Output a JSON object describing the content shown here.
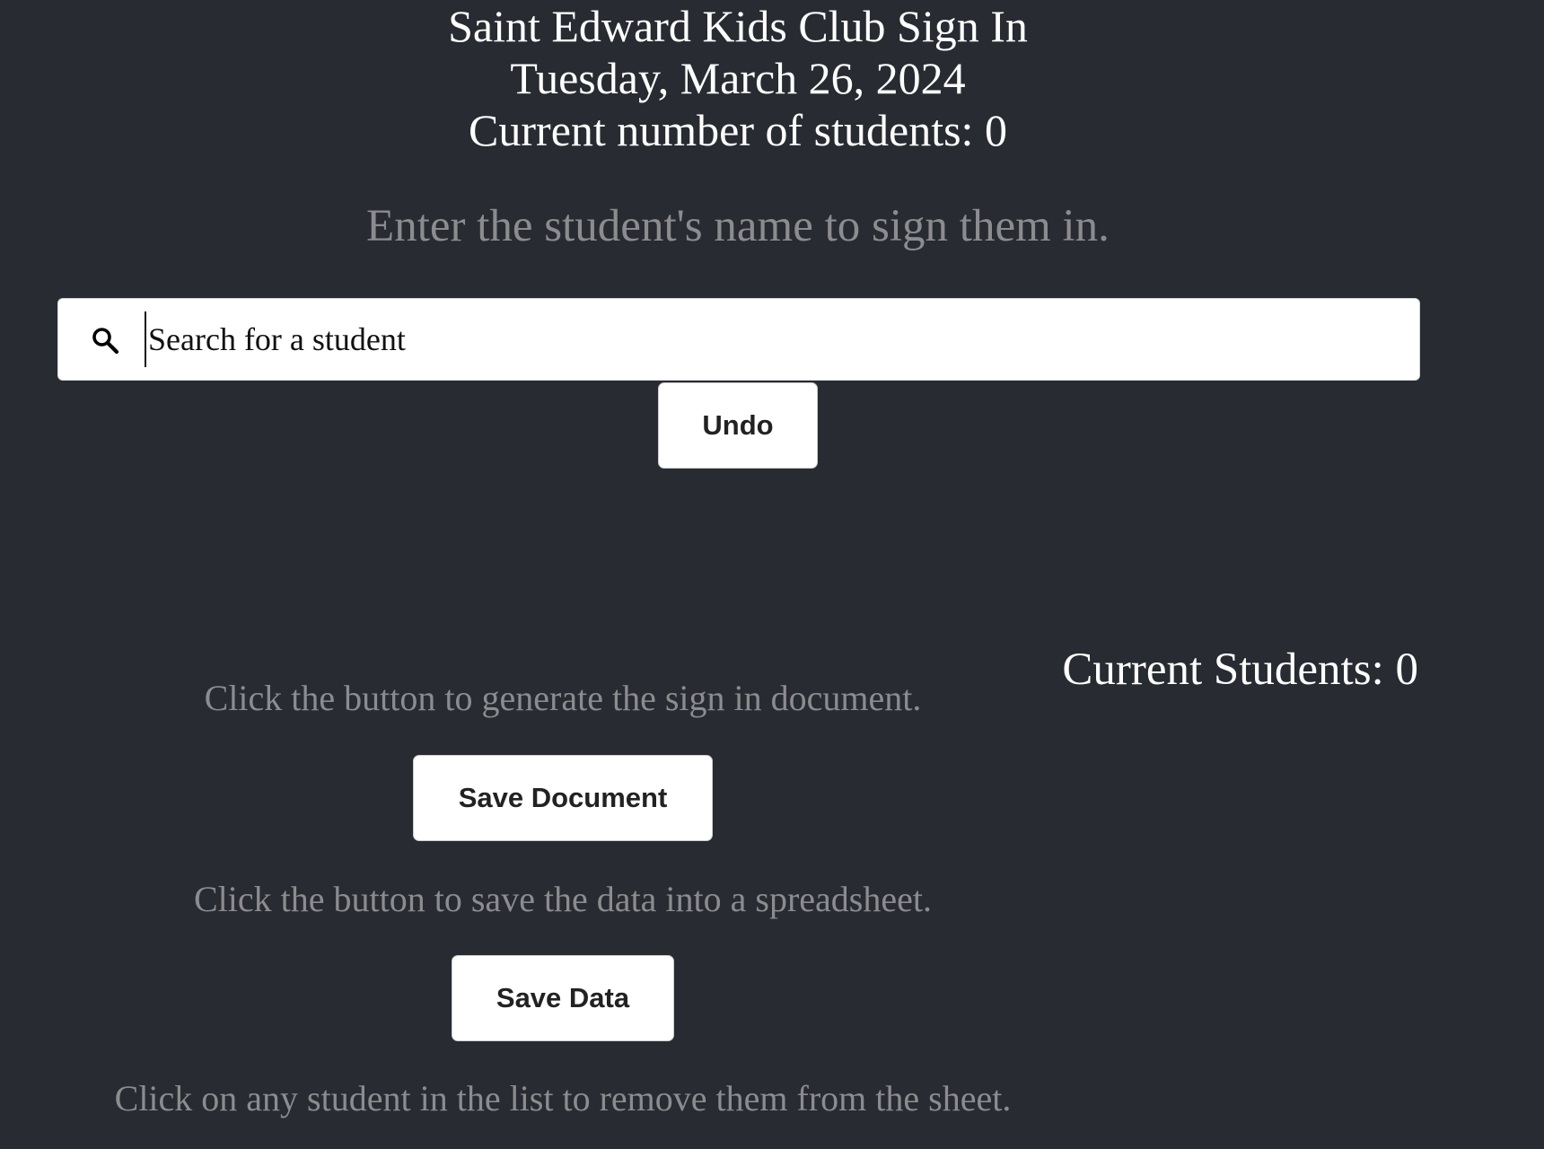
{
  "header": {
    "title": "Saint Edward Kids Club Sign In",
    "date": "Tuesday, March 26, 2024",
    "student_count": "Current number of students: 0"
  },
  "instruction": "Enter the student's name to sign them in.",
  "search": {
    "placeholder": "Search for a student",
    "value": "",
    "icon": "search-icon"
  },
  "buttons": {
    "undo": "Undo",
    "save_document": "Save Document",
    "save_data": "Save Data"
  },
  "current_students": "Current Students: 0",
  "hints": {
    "document": "Click the button to generate the sign in document.",
    "data": "Click the button to save the data into a spreadsheet.",
    "remove": "Click on any student in the list to remove them from the sheet."
  },
  "colors": {
    "background": "#282b31",
    "muted_text": "#8c8c8f",
    "heading_text": "#ffffff"
  }
}
